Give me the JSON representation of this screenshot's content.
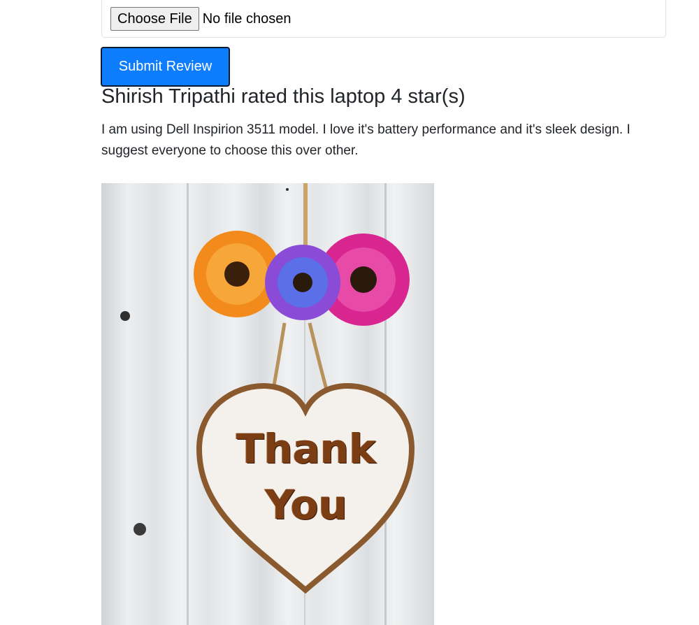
{
  "upload": {
    "choose_label": "Choose File",
    "status": "No file chosen"
  },
  "form": {
    "submit_label": "Submit Review"
  },
  "review": {
    "heading": "Shirish Tripathi rated this laptop 4 star(s)",
    "text": "I am using Dell Inspirion 3511 model. I love it's battery performance and it's sleek design. I suggest everyone to choose this over other.",
    "rating": 4
  },
  "image": {
    "word1": "Thank",
    "word2": "You"
  },
  "colors": {
    "accent": "#0d7dfd",
    "text": "#212529"
  }
}
